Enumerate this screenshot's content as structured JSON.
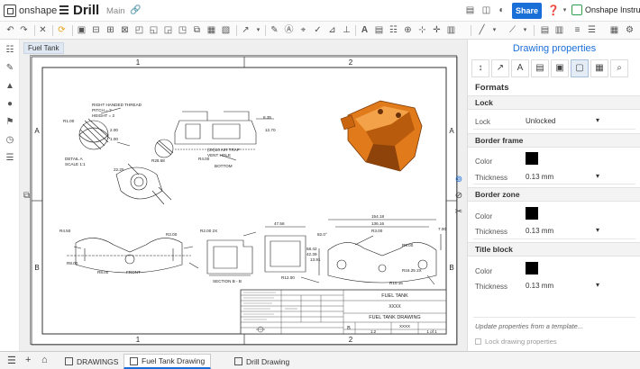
{
  "header": {
    "logo_text": "onshape",
    "document_title": "Drill",
    "branch": "Main",
    "share_label": "Share",
    "help_label": "?",
    "company_name": "Onshape Instruct"
  },
  "canvas": {
    "drawing_label": "Fuel Tank",
    "zone_columns": [
      "1",
      "2"
    ],
    "zone_rows": [
      "A",
      "B"
    ]
  },
  "drawing": {
    "thread_note": [
      "RIGHT HANDED THREAD",
      "PITCH = ?",
      "HEIGHT = 2"
    ],
    "dims_top": [
      "R1.00",
      "2.00",
      "1.00",
      "8.35",
      "R4.00",
      "R28.58",
      "22.25",
      "12.70"
    ],
    "detail_label": [
      "DETAIL A",
      "SCALE 1:1"
    ],
    "bottom_label": "BOTTOM",
    "front_label": "FRONT",
    "section_label": "SECTION B - B",
    "hole_note": [
      "(3X)10 AIR TRAP",
      "VENT HOLE"
    ],
    "dims_bottom": [
      "R4.50",
      "R2.00",
      "R2.00 2X",
      "R8.00",
      "R8.00",
      "R12.00",
      "R3.00",
      "R9.00",
      "R16.25 2X",
      "R10.16",
      "154.18",
      "136.16",
      "47.56",
      "7.00",
      "82.0°",
      "13.91",
      "58.42",
      "42.39"
    ],
    "title_block": {
      "part_name": "FUEL TANK",
      "drawing_name": "FUEL TANK DRAWING",
      "size": "B",
      "scale": "1:2",
      "sheet": "1 of 1",
      "values": [
        "XXXX",
        "XXXX"
      ]
    }
  },
  "panel": {
    "title": "Drawing properties",
    "heading": "Formats",
    "sections": {
      "lock": {
        "title": "Lock",
        "lock_label": "Lock",
        "lock_value": "Unlocked"
      },
      "border_frame": {
        "title": "Border frame",
        "color_label": "Color",
        "thickness_label": "Thickness",
        "thickness_value": "0.13 mm"
      },
      "border_zone": {
        "title": "Border zone",
        "color_label": "Color",
        "thickness_label": "Thickness",
        "thickness_value": "0.13 mm"
      },
      "title_block": {
        "title": "Title block",
        "color_label": "Color",
        "thickness_label": "Thickness",
        "thickness_value": "0.13 mm"
      }
    },
    "template_link": "Update properties from a template...",
    "lock_checkbox_label": "Lock drawing properties"
  },
  "bottom_tabs": [
    {
      "label": "DRAWINGS",
      "icon": "folder-icon"
    },
    {
      "label": "Fuel Tank Drawing",
      "icon": "drawing-icon"
    },
    {
      "label": "Drill Drawing",
      "icon": "drawing-icon"
    }
  ],
  "colors": {
    "accent": "#1a6ed8",
    "part_orange": "#e07a1a",
    "company_green": "#2c9f4f"
  }
}
